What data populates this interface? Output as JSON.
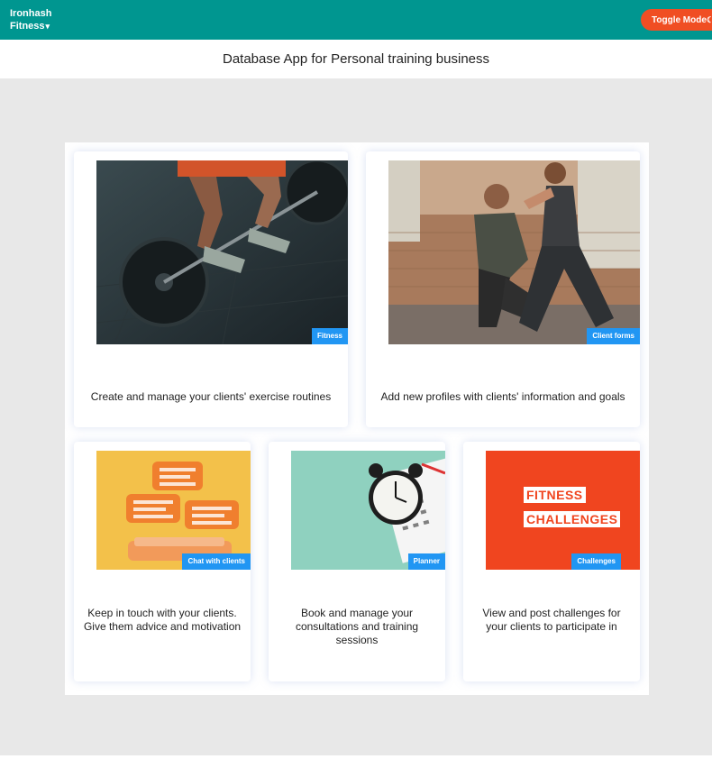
{
  "nav": {
    "brand_line1": "Ironhash",
    "brand_line2": "Fitness",
    "caret": "▾",
    "toggle_label": "Toggle Mode",
    "toggle_icon": "☾"
  },
  "header": {
    "title": "Database App for Personal training business"
  },
  "cards": [
    {
      "tag": "Fitness",
      "description": "Create and manage your clients' exercise routines"
    },
    {
      "tag": "Client forms",
      "description": "Add new profiles with clients' information and goals"
    },
    {
      "tag": "Chat with clients",
      "description": "Keep in touch with your clients. Give them advice and motivation"
    },
    {
      "tag": "Planner",
      "description": "Book and manage your consultations and training sessions"
    },
    {
      "tag": "Challenges",
      "description": "View and post challenges for your clients to participate in",
      "image_text": [
        "FITNESS",
        "CHALLENGES"
      ]
    }
  ],
  "colors": {
    "nav": "#009690",
    "accent": "#f04e23",
    "tag": "#2196f3"
  }
}
